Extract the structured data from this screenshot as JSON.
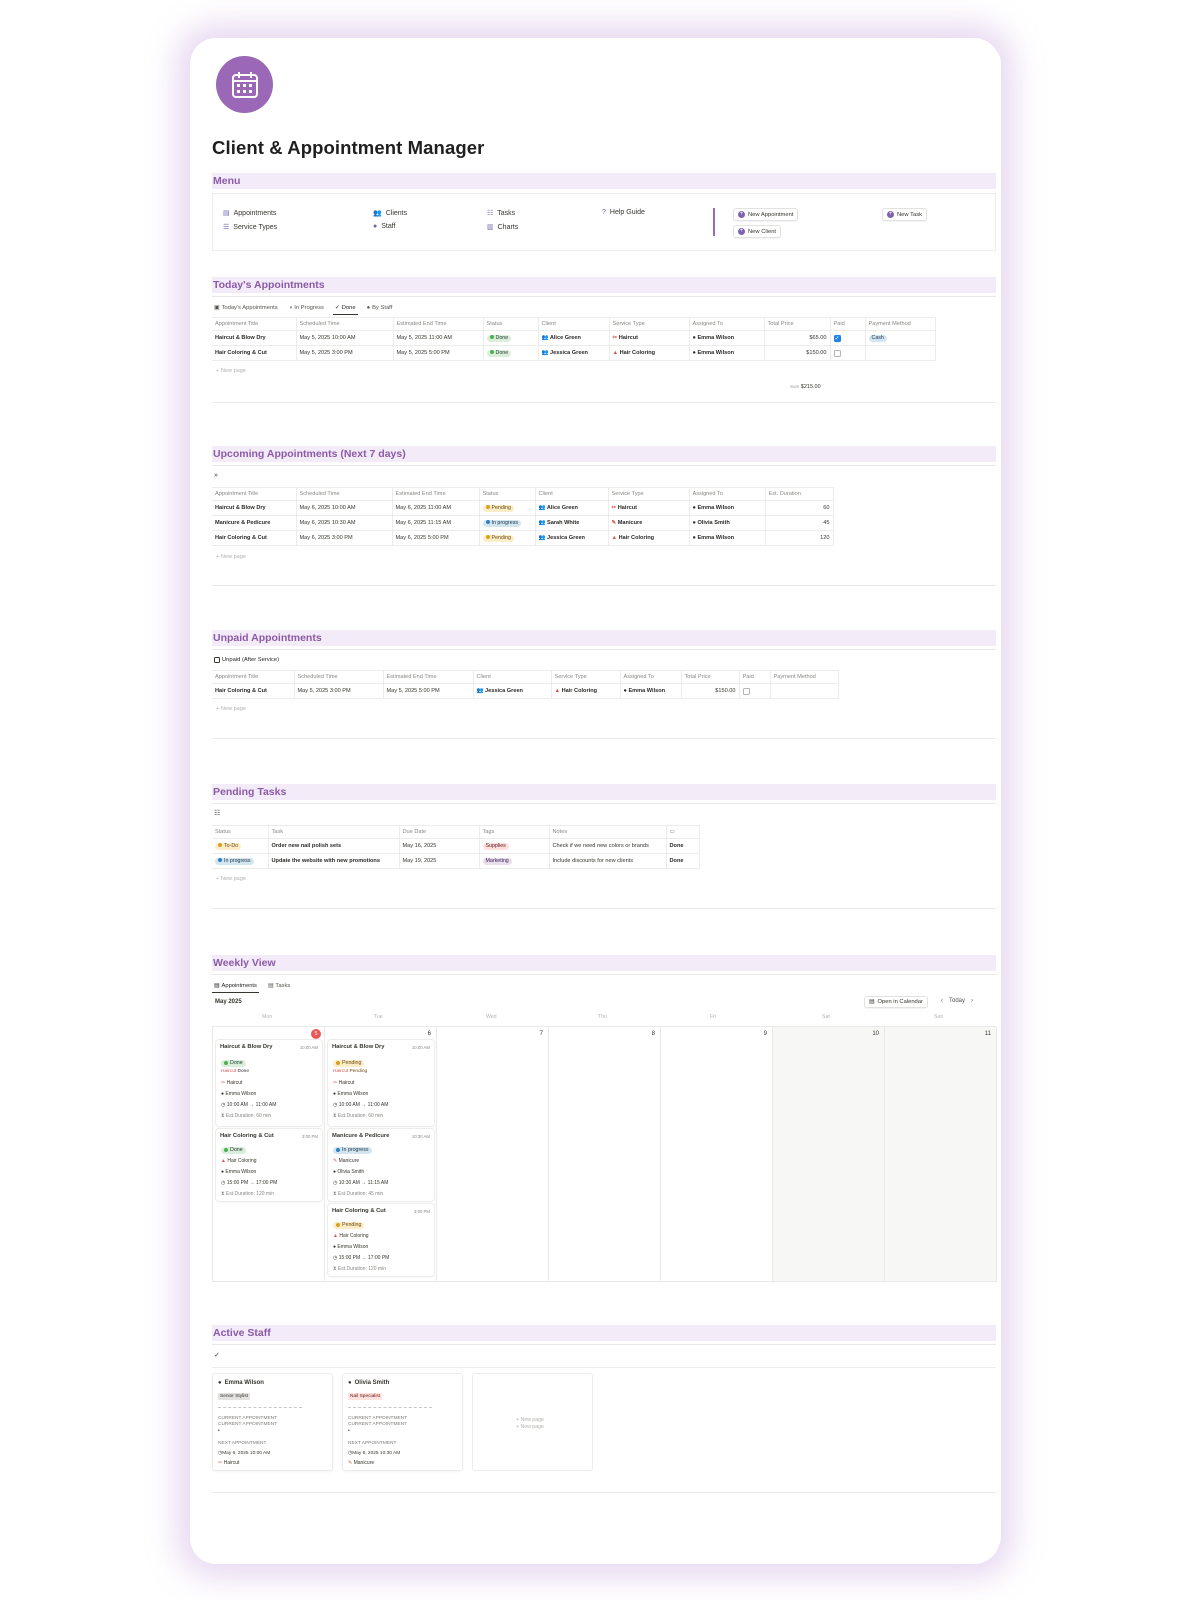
{
  "page": {
    "title": "Client & Appointment Manager"
  },
  "menu": {
    "heading": "Menu",
    "items": [
      {
        "label": "Appointments",
        "icon": "calendar-icon"
      },
      {
        "label": "Service Types",
        "icon": "list-icon"
      },
      {
        "label": "Clients",
        "icon": "people-icon"
      },
      {
        "label": "Staff",
        "icon": "person-icon"
      },
      {
        "label": "Tasks",
        "icon": "checklist-icon"
      },
      {
        "label": "Charts",
        "icon": "chart-icon"
      },
      {
        "label": "Help Guide",
        "icon": "question-icon"
      }
    ],
    "buttons": {
      "new_appointment": "New Appointment",
      "new_client": "New Client",
      "new_task": "New Task"
    }
  },
  "today": {
    "heading": "Today's Appointments",
    "tabs": [
      "Today's Appointments",
      "In Progress",
      "Done",
      "By Staff"
    ],
    "active_tab": "Done",
    "columns": [
      "Appointment Title",
      "Scheduled Time",
      "Estimated End Time",
      "Status",
      "Client",
      "Service Type",
      "Assigned To",
      "Total Price",
      "Paid",
      "Payment Method"
    ],
    "rows": [
      {
        "title": "Haircut & Blow Dry",
        "scheduled": "May 5, 2025 10:00 AM",
        "end": "May 5, 2025 11:00 AM",
        "status": "Done",
        "client": "Alice Green",
        "service": "Haircut",
        "assigned": "Emma Wilson",
        "price": "$65.00",
        "paid": true,
        "method": "Cash"
      },
      {
        "title": "Hair Coloring & Cut",
        "scheduled": "May 5, 2025 3:00 PM",
        "end": "May 5, 2025 5:00 PM",
        "status": "Done",
        "client": "Jessica Green",
        "service": "Hair Coloring",
        "assigned": "Emma Wilson",
        "price": "$150.00",
        "paid": false,
        "method": ""
      }
    ],
    "new_page": "New page",
    "sum_label": "Sum",
    "sum_value": "$215.00"
  },
  "upcoming": {
    "heading": "Upcoming Appointments (Next 7 days)",
    "columns": [
      "Appointment Title",
      "Scheduled Time",
      "Estimated End Time",
      "Status",
      "Client",
      "Service Type",
      "Assigned To",
      "Est. Duration"
    ],
    "rows": [
      {
        "title": "Haircut & Blow Dry",
        "scheduled": "May 6, 2025 10:00 AM",
        "end": "May 6, 2025 11:00 AM",
        "status": "Pending",
        "client": "Alice Green",
        "service": "Haircut",
        "assigned": "Emma Wilson",
        "duration": "60"
      },
      {
        "title": "Manicure & Pedicure",
        "scheduled": "May 6, 2025 10:30 AM",
        "end": "May 6, 2025 11:15 AM",
        "status": "In progress",
        "client": "Sarah White",
        "service": "Manicure",
        "assigned": "Olivia Smith",
        "duration": "45"
      },
      {
        "title": "Hair Coloring & Cut",
        "scheduled": "May 6, 2025 3:00 PM",
        "end": "May 6, 2025 5:00 PM",
        "status": "Pending",
        "client": "Jessica Green",
        "service": "Hair Coloring",
        "assigned": "Emma Wilson",
        "duration": "120"
      }
    ],
    "new_page": "New page"
  },
  "unpaid": {
    "heading": "Unpaid Appointments",
    "tab": "Unpaid (After Service)",
    "columns": [
      "Appointment Title",
      "Scheduled Time",
      "Estimated End Time",
      "Client",
      "Service Type",
      "Assigned To",
      "Total Price",
      "Paid",
      "Payment Method"
    ],
    "rows": [
      {
        "title": "Hair Coloring & Cut",
        "scheduled": "May 5, 2025 3:00 PM",
        "end": "May 5, 2025 5:00 PM",
        "client": "Jessica Green",
        "service": "Hair Coloring",
        "assigned": "Emma Wilson",
        "price": "$150.00",
        "paid": false,
        "method": ""
      }
    ],
    "new_page": "New page"
  },
  "tasks": {
    "heading": "Pending Tasks",
    "columns": [
      "Status",
      "Task",
      "Due Date",
      "Tags",
      "Notes"
    ],
    "rows": [
      {
        "status": "To-Do",
        "task": "Order new nail polish sets",
        "due": "May 16, 2025",
        "tag": "Supplies",
        "notes": "Check if we need new colors or brands",
        "action": "Done"
      },
      {
        "status": "In progress",
        "task": "Update the website with new promotions",
        "due": "May 19, 2025",
        "tag": "Marketing",
        "notes": "Include discounts for new clients",
        "action": "Done"
      }
    ],
    "new_page": "New page"
  },
  "weekly": {
    "heading": "Weekly View",
    "tabs": [
      "Appointments",
      "Tasks"
    ],
    "month": "May 2025",
    "open_calendar": "Open in Calendar",
    "today_btn": "Today",
    "weekdays": [
      "Mon",
      "Tue",
      "Wed",
      "Thu",
      "Fri",
      "Sat",
      "Sun"
    ],
    "day_numbers": [
      "5",
      "6",
      "7",
      "8",
      "9",
      "10",
      "11"
    ],
    "events": {
      "mon": [
        {
          "title": "Haircut & Blow Dry",
          "time": "10:00 AM",
          "status": "Done",
          "service": "Haircut",
          "staff": "Emma Wilson",
          "range": "10:00 AM → 11:00 AM",
          "duration": "Est.Duration: 60 min",
          "overlap": "Done",
          "overlap2": "Haircut"
        },
        {
          "title": "Hair Coloring & Cut",
          "time": "3:00 PM",
          "status": "Done",
          "service": "Hair Coloring",
          "staff": "Emma Wilson",
          "range": "15:00 PM → 17:00 PM",
          "duration": "Est.Duration: 120 min"
        }
      ],
      "tue": [
        {
          "title": "Haircut & Blow Dry",
          "time": "10:00 AM",
          "status": "Pending",
          "service": "Haircut",
          "staff": "Emma Wilson",
          "range": "10:00 AM → 11:00 AM",
          "duration": "Est.Duration: 60 min",
          "overlap": "Pending",
          "overlap2": "Haircut"
        },
        {
          "title": "Manicure & Pedicure",
          "time": "10:30 AM",
          "status": "In progress",
          "service": "Manicure",
          "staff": "Olivia Smith",
          "range": "10:30 AM → 11:15 AM",
          "duration": "Est.Duration: 45 min"
        },
        {
          "title": "Hair Coloring & Cut",
          "time": "3:00 PM",
          "status": "Pending",
          "service": "Hair Coloring",
          "staff": "Emma Wilson",
          "range": "15:00 PM → 17:00 PM",
          "duration": "Est.Duration: 120 min"
        }
      ]
    }
  },
  "staff": {
    "heading": "Active Staff",
    "cards": [
      {
        "name": "Emma Wilson",
        "role": "Senior Stylist",
        "current1": "CURRENT APPOINTMENT",
        "current2": "CURRENT APPOINTMENT",
        "next_label": "NEXT APPOINTMENT",
        "next_time": "May 6, 2025 10:00 AM",
        "next_service": "Haircut"
      },
      {
        "name": "Olivia Smith",
        "role": "Nail Specialist",
        "current1": "CURRENT APPOINTMENT",
        "current2": "CURRENT APPOINTMENT",
        "next_label": "NEXT APPOINTMENT",
        "next_time": "May 6, 2025 10:30 AM",
        "next_service": "Manicure"
      }
    ],
    "new_page_1": "New page",
    "new_page_2": "New page"
  }
}
